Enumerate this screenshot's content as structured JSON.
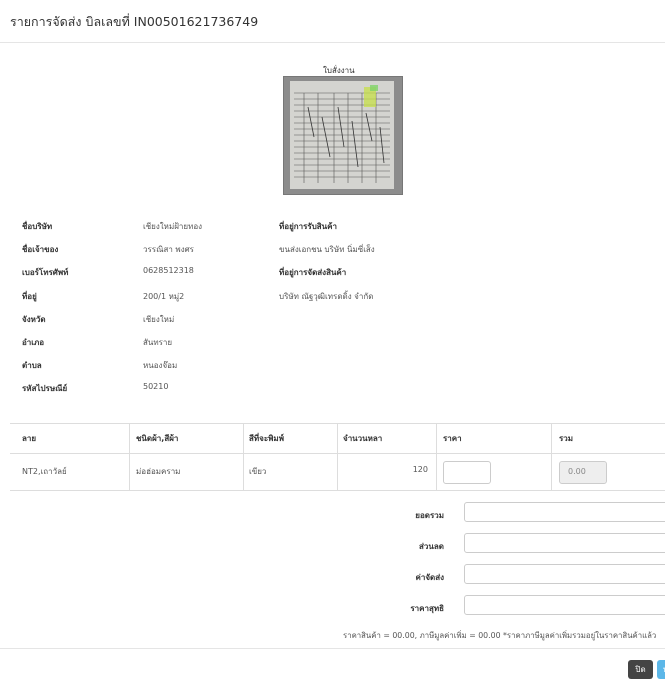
{
  "header": {
    "title": "รายการจัดส่ง บิลเลขที่ IN00501621736749",
    "close_glyph": "("
  },
  "image": {
    "caption": "ใบสั่งงาน"
  },
  "customer": {
    "fields": [
      {
        "label": "ชื่อบริษัท",
        "value": "เชียงใหม่ฝ้ายทอง"
      },
      {
        "label": "ชื่อเจ้าของ",
        "value": "วรรณิสา พงศร"
      },
      {
        "label": "เบอร์โทรศัพท์",
        "value": "0628512318"
      },
      {
        "label": "ที่อยู่",
        "value": "200/1 หมู่2"
      },
      {
        "label": "จังหวัด",
        "value": "เชียงใหม่"
      },
      {
        "label": "อำเภอ",
        "value": "สันทราย"
      },
      {
        "label": "ตำบล",
        "value": "หนองจ๊อม"
      },
      {
        "label": "รหัสไปรษณีย์",
        "value": "50210"
      }
    ]
  },
  "delivery": {
    "pickup_label": "ที่อยู่การรับสินค้า",
    "pickup_value": "ขนส่งเอกชน บริษัท นิ่มซี่เส็ง",
    "ship_label": "ที่อยู่การจัดส่งสินค้า",
    "ship_value": "บริษัท ณัฐวุฒิเทรดดิ้ง จำกัด"
  },
  "table": {
    "headers": [
      "ลาย",
      "ชนิดผ้า,สีผ้า",
      "สีที่จะพิมพ์",
      "จำนวนหลา",
      "ราคา",
      "รวม"
    ],
    "row": {
      "pattern": "NT2,เถาวัลย์",
      "fabric": "ม่อฮ่อมคราม",
      "print_color": "เขียว",
      "yards": "120",
      "price": "",
      "total": "0.00"
    }
  },
  "summary": {
    "subtotal_label": "ยอดรวม",
    "discount_label": "ส่วนลด",
    "shipping_label": "ค่าจัดส่ง",
    "net_label": "ราคาสุทธิ",
    "note": "ราคาสินค้า = 00.00, ภาษีมูลค่าเพิ่ม = 00.00   *ราคาภาษีมูลค่าเพิ่มรวมอยู่ในราคาสินค้าแล้ว"
  },
  "footer": {
    "close_label": "ปิด",
    "save_label": "บันทึก"
  }
}
